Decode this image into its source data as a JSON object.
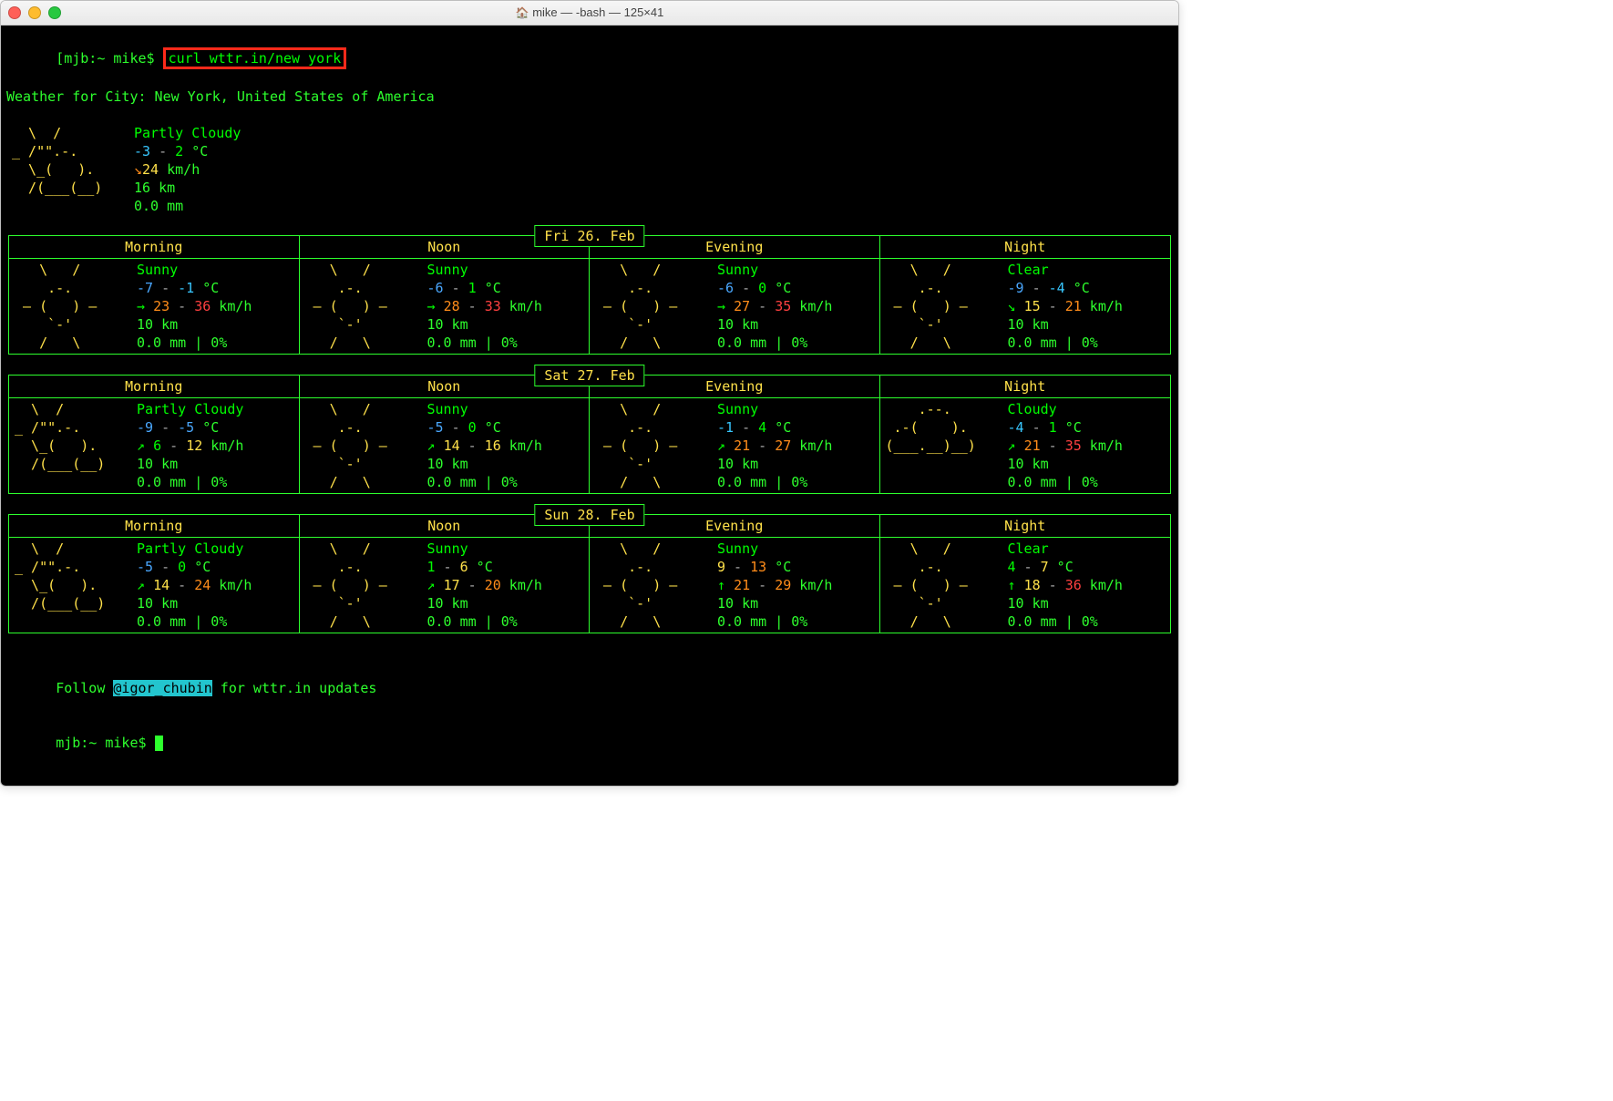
{
  "window": {
    "title": "mike — -bash — 125×41"
  },
  "prompt": {
    "text": "[mjb:~ mike$ ",
    "command": "curl wttr.in/new york",
    "prompt2": "mjb:~ mike$ "
  },
  "header_line": "Weather for City: New York, United States of America",
  "current": {
    "condition": "Partly Cloudy",
    "temp_lo": "-3",
    "temp_hi": "2",
    "temp_unit": "°C",
    "wind_arrow": "↘",
    "wind": "24",
    "wind_unit": "km/h",
    "vis": "16 km",
    "precip": "0.0 mm"
  },
  "ascii": {
    "partly": "  \\  /      \n_ /\"\".-.    \n  \\_(   ).  \n  /(___(__) ",
    "sunny": "   \\   /    \n    .-.     \n ‒ (   ) ‒  \n    `-'     \n   /   \\    ",
    "cloudy": "    .--.    \n .-(    ).  \n(___.__)__) "
  },
  "days": [
    {
      "date": "Fri 26. Feb",
      "periods": {
        "Morning": {
          "ascii": "sunny",
          "cond": "Sunny",
          "t_lo": "-7",
          "t_hi": "-1",
          "w_arrow": "→",
          "w_lo": "23",
          "w_hi": "36",
          "vis": "10 km",
          "precip": "0.0 mm | 0%"
        },
        "Noon": {
          "ascii": "sunny",
          "cond": "Sunny",
          "t_lo": "-6",
          "t_hi": "1",
          "w_arrow": "→",
          "w_lo": "28",
          "w_hi": "33",
          "vis": "10 km",
          "precip": "0.0 mm | 0%"
        },
        "Evening": {
          "ascii": "sunny",
          "cond": "Sunny",
          "t_lo": "-6",
          "t_hi": "0",
          "w_arrow": "→",
          "w_lo": "27",
          "w_hi": "35",
          "vis": "10 km",
          "precip": "0.0 mm | 0%"
        },
        "Night": {
          "ascii": "sunny",
          "cond": "Clear",
          "t_lo": "-9",
          "t_hi": "-4",
          "w_arrow": "↘",
          "w_lo": "15",
          "w_hi": "21",
          "vis": "10 km",
          "precip": "0.0 mm | 0%"
        }
      }
    },
    {
      "date": "Sat 27. Feb",
      "periods": {
        "Morning": {
          "ascii": "partly",
          "cond": "Partly Cloudy",
          "t_lo": "-9",
          "t_hi": "-5",
          "w_arrow": "↗",
          "w_lo": "6",
          "w_hi": "12",
          "vis": "10 km",
          "precip": "0.0 mm | 0%"
        },
        "Noon": {
          "ascii": "sunny",
          "cond": "Sunny",
          "t_lo": "-5",
          "t_hi": "0",
          "w_arrow": "↗",
          "w_lo": "14",
          "w_hi": "16",
          "vis": "10 km",
          "precip": "0.0 mm | 0%"
        },
        "Evening": {
          "ascii": "sunny",
          "cond": "Sunny",
          "t_lo": "-1",
          "t_hi": "4",
          "w_arrow": "↗",
          "w_lo": "21",
          "w_hi": "27",
          "vis": "10 km",
          "precip": "0.0 mm | 0%"
        },
        "Night": {
          "ascii": "cloudy",
          "cond": "Cloudy",
          "t_lo": "-4",
          "t_hi": "1",
          "w_arrow": "↗",
          "w_lo": "21",
          "w_hi": "35",
          "vis": "10 km",
          "precip": "0.0 mm | 0%"
        }
      }
    },
    {
      "date": "Sun 28. Feb",
      "periods": {
        "Morning": {
          "ascii": "partly",
          "cond": "Partly Cloudy",
          "t_lo": "-5",
          "t_hi": "0",
          "w_arrow": "↗",
          "w_lo": "14",
          "w_hi": "24",
          "vis": "10 km",
          "precip": "0.0 mm | 0%"
        },
        "Noon": {
          "ascii": "sunny",
          "cond": "Sunny",
          "t_lo": "1",
          "t_hi": "6",
          "w_arrow": "↗",
          "w_lo": "17",
          "w_hi": "20",
          "vis": "10 km",
          "precip": "0.0 mm | 0%"
        },
        "Evening": {
          "ascii": "sunny",
          "cond": "Sunny",
          "t_lo": "9",
          "t_hi": "13",
          "w_arrow": "↑",
          "w_lo": "21",
          "w_hi": "29",
          "vis": "10 km",
          "precip": "0.0 mm | 0%"
        },
        "Night": {
          "ascii": "sunny",
          "cond": "Clear",
          "t_lo": "4",
          "t_hi": "7",
          "w_arrow": "↑",
          "w_lo": "18",
          "w_hi": "36",
          "vis": "10 km",
          "precip": "0.0 mm | 0%"
        }
      }
    }
  ],
  "period_labels": [
    "Morning",
    "Noon",
    "Evening",
    "Night"
  ],
  "footer": {
    "follow": "Follow ",
    "handle": "@igor_chubin",
    "tail": " for wttr.in updates"
  }
}
